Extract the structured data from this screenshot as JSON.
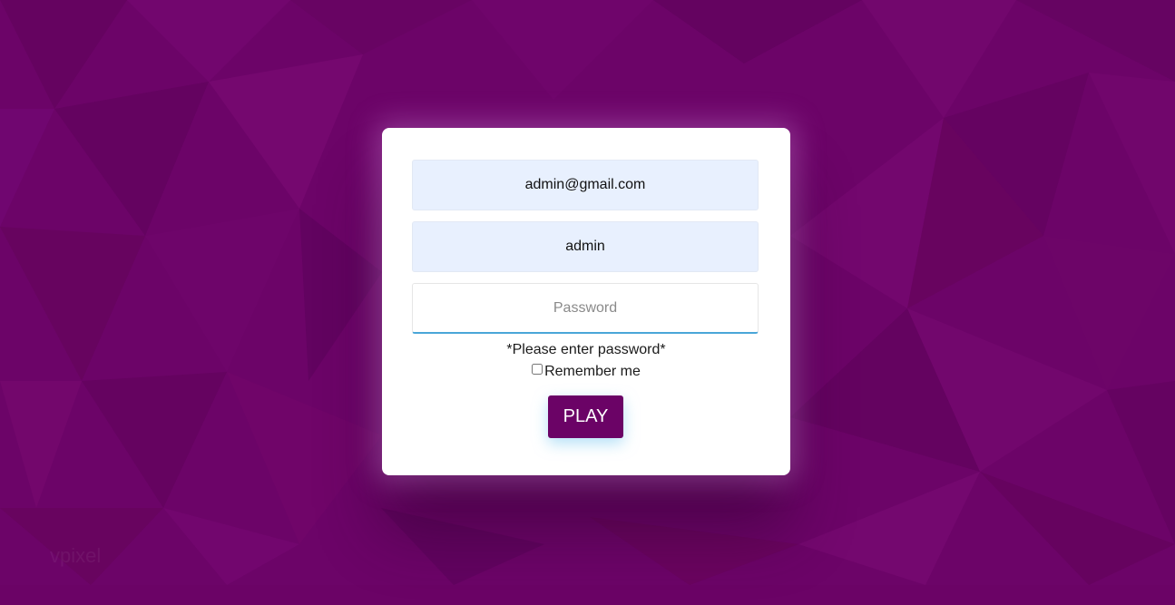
{
  "theme": {
    "background": "#6c0468",
    "accent": "#6b0366",
    "input_fill": "#e8f0fe",
    "focus_line": "#4aa6d8"
  },
  "form": {
    "email_value": "admin@gmail.com",
    "username_value": "admin",
    "password_value": "",
    "password_placeholder": "Password",
    "error_message": "*Please enter password*",
    "remember_label": "Remember me",
    "remember_checked": false,
    "submit_label": "PLAY"
  }
}
